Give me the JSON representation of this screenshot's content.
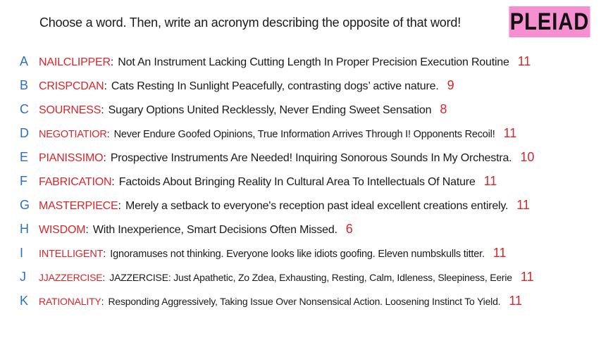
{
  "header": {
    "instruction": "Choose a word. Then, write an acronym describing the opposite of that word!",
    "logo_text": "PLEIAD"
  },
  "colors": {
    "letter": "#2a6fc9",
    "word": "#d9262a",
    "count": "#d9262a",
    "text": "#1a1a1a",
    "logo_bg": "#f58fcf"
  },
  "rows": [
    {
      "letter": "A",
      "word": "NAILCLIPPER",
      "acronym": "Not An Instrument Lacking Cutting Length In Proper Precision Execution Routine",
      "count": "11"
    },
    {
      "letter": "B",
      "word": "CRISPCDAN",
      "acronym": "Cats Resting In Sunlight Peacefully, contrasting dogs’ active nature.",
      "count": "9"
    },
    {
      "letter": "C",
      "word": "SOURNESS",
      "acronym": "Sugary Options United Recklessly, Never Ending Sweet Sensation",
      "count": "8"
    },
    {
      "letter": "D",
      "word": "NEGOTIATIOR",
      "acronym": "Never Endure Goofed Opinions, True Information Arrives Through I! Opponents Recoil!",
      "count": "11"
    },
    {
      "letter": "E",
      "word": "PIANISSIMO",
      "acronym": "Prospective Instruments Are Needed! Inquiring Sonorous Sounds In My Orchestra.",
      "count": "10"
    },
    {
      "letter": "F",
      "word": "FABRICATION",
      "acronym": "Factoids About Bringing Reality In Cultural Area To Intellectuals Of Nature",
      "count": "11"
    },
    {
      "letter": "G",
      "word": "MASTERPIECE",
      "acronym": "Merely a setback to everyone's reception past ideal excellent creations entirely.",
      "count": "11"
    },
    {
      "letter": "H",
      "word": "WISDOM",
      "acronym": "With Inexperience, Smart Decisions Often Missed.",
      "count": "6"
    },
    {
      "letter": "I",
      "word": "INTELLIGENT",
      "acronym": "Ignoramuses not thinking. Everyone looks like idiots goofing. Eleven numbskulls titter.",
      "count": "11"
    },
    {
      "letter": "J",
      "word": "JJAZZERCISE",
      "acronym": "JAZZERCISE: Just Apathetic, Zo Zdea, Exhausting, Resting, Calm, Idleness, Sleepiness, Eerie",
      "count": "11"
    },
    {
      "letter": "K",
      "word": "RATIONALITY",
      "acronym": "Responding Aggressively, Taking Issue Over Nonsensical Action. Loosening Instinct To Yield.",
      "count": "11"
    }
  ]
}
